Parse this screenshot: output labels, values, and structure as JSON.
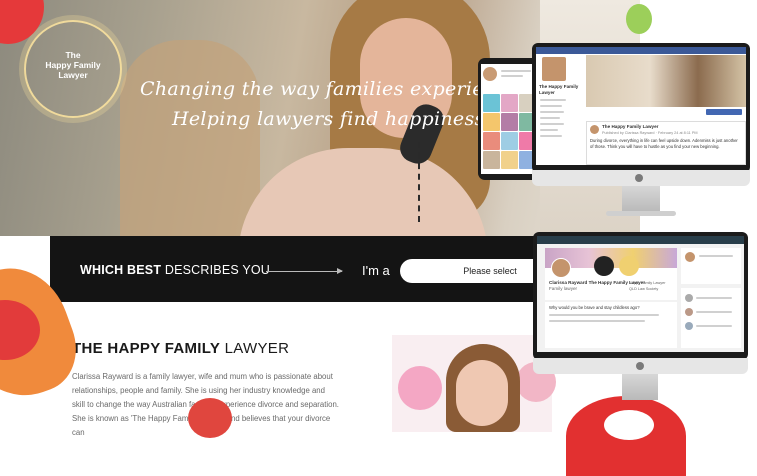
{
  "brand": {
    "logo_text": "The\nHappy Family\nLawyer"
  },
  "hero": {
    "tagline_line1": "Changing the way families experience separation and",
    "tagline_line2": "Helping lawyers find happiness in law and in"
  },
  "selector": {
    "which_bold": "WHICH BEST",
    "which_light": "DESCRIBES YOU",
    "prefix": "I'm a",
    "placeholder": "Please select"
  },
  "about": {
    "heading_bold": "THE HAPPY FAMILY",
    "heading_light": "LAWYER",
    "paragraph": "Clarissa Rayward is a family lawyer, wife and mum who is passionate about relationships, people and family. She is using her industry knowledge and skill to change the way Australian families experience divorce and separation. She is known as 'The Happy Family Lawyer' and believes that your divorce can"
  },
  "facebook_mockup": {
    "page_name": "The Happy Family Lawyer",
    "post_author": "The Happy Family Lawyer",
    "post_meta": "Published by Clarissa Rayward · February 24 at 8:11 PM",
    "post_text": "During divorce, everything in life can feel upside down. Adenmiss is just another of those. Think you will have to hustle as you find your new beginning."
  },
  "linkedin_mockup": {
    "profile_name": "Clarissa Rayward The Happy Family Lawyer",
    "profile_sub": "Family lawyer",
    "badge1": "Happy Family Lawyer",
    "badge2": "QLD Law Society",
    "post_text": "Why would you be brave and stay childless ago?"
  },
  "colors": {
    "bar": "#141414",
    "accent_red": "#e5393a",
    "accent_orange": "#f08a3c",
    "facebook_blue": "#3b5998",
    "linkedin_navy": "#283e4a"
  }
}
